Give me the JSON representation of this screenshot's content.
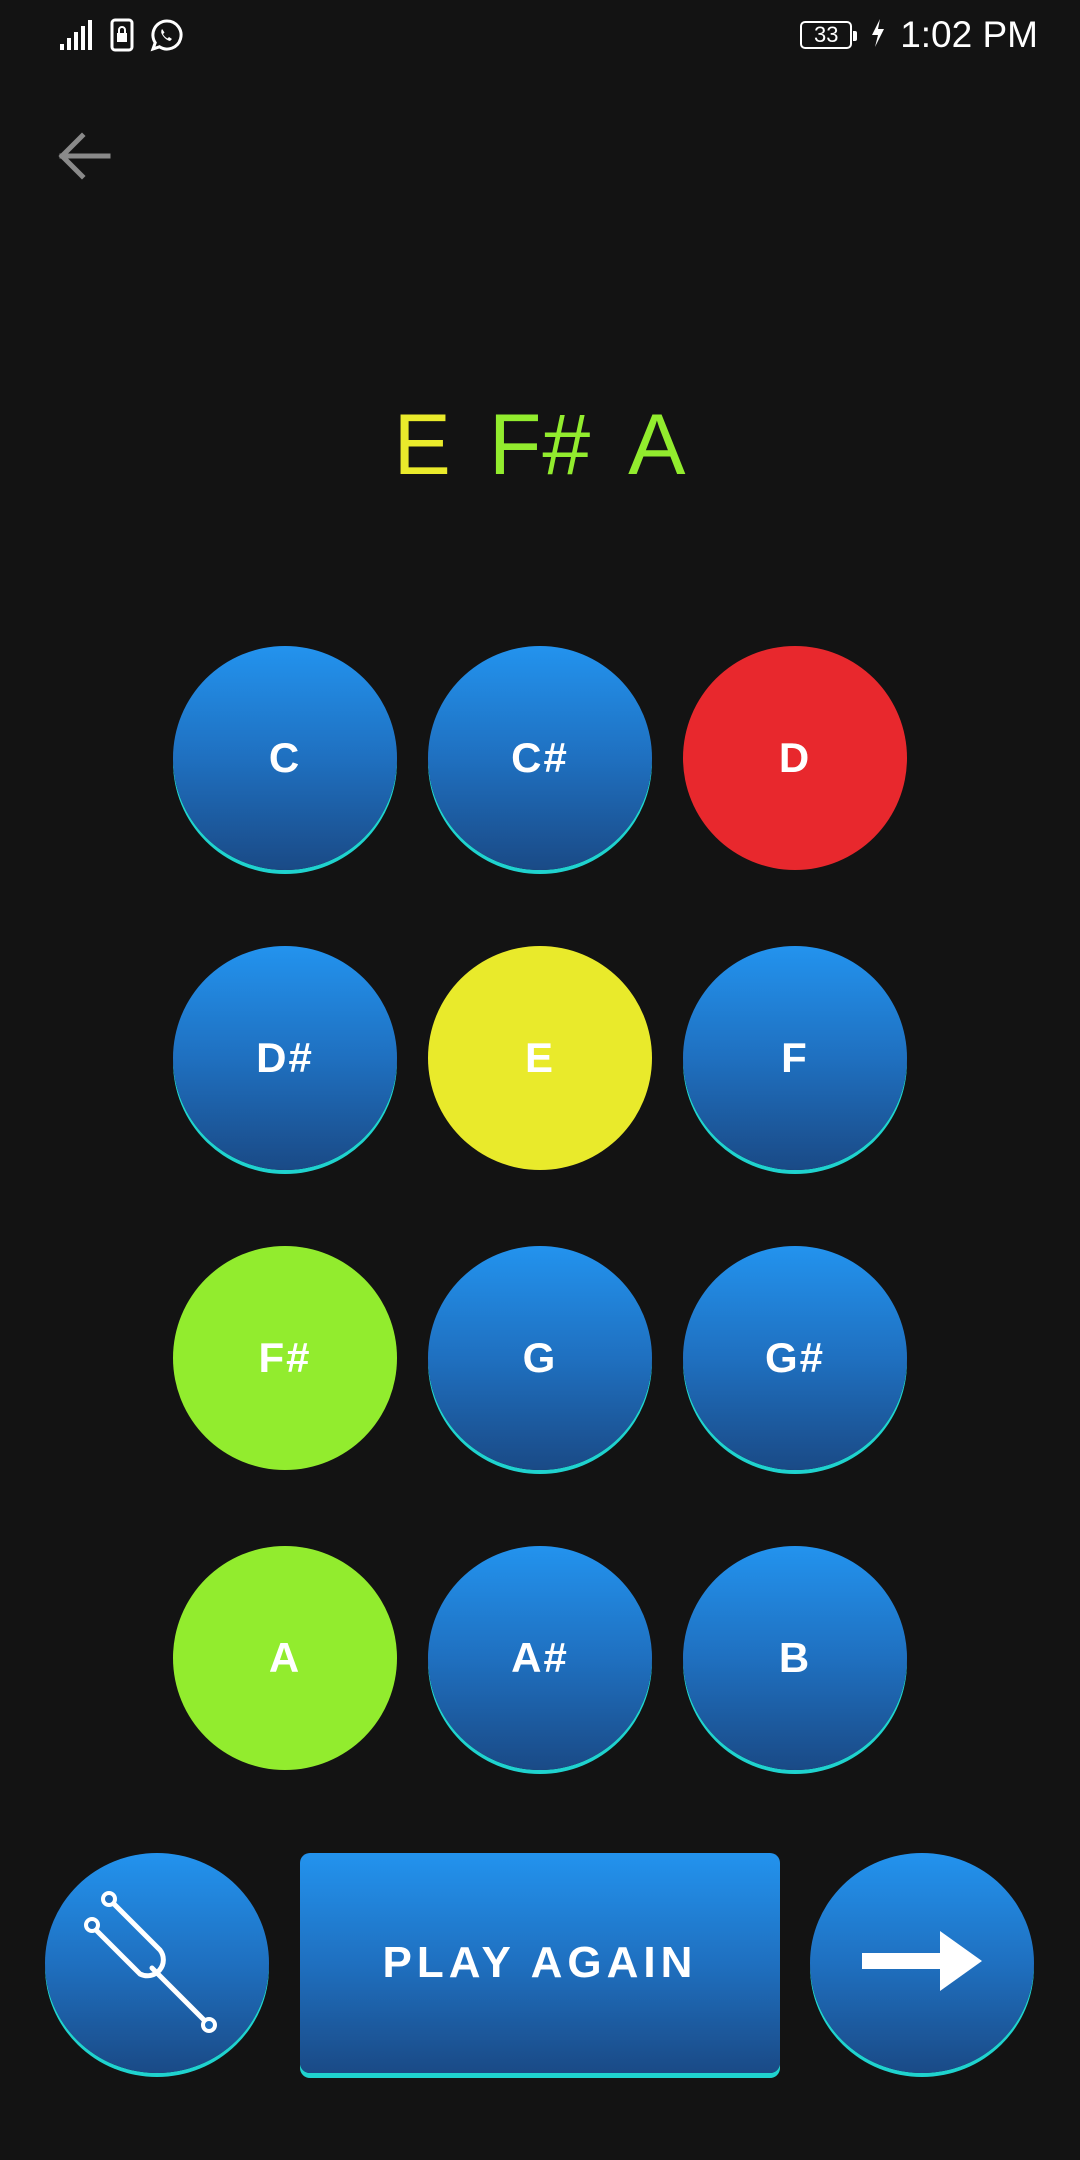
{
  "status_bar": {
    "battery_level": "33",
    "time": "1:02 PM",
    "icons": [
      "signal-icon",
      "sim-lock-icon",
      "whatsapp-icon",
      "battery-icon",
      "charging-icon"
    ]
  },
  "header": {
    "back_icon": "arrow-left-icon"
  },
  "answer": {
    "notes": [
      {
        "label": "E",
        "color": "#e9ea2b"
      },
      {
        "label": "F#",
        "color": "#92ec2e"
      },
      {
        "label": "A",
        "color": "#92ec2e"
      }
    ]
  },
  "notes": [
    {
      "label": "C",
      "state": "default"
    },
    {
      "label": "C#",
      "state": "default"
    },
    {
      "label": "D",
      "state": "wrong"
    },
    {
      "label": "D#",
      "state": "default"
    },
    {
      "label": "E",
      "state": "partial"
    },
    {
      "label": "F",
      "state": "default"
    },
    {
      "label": "F#",
      "state": "correct"
    },
    {
      "label": "G",
      "state": "default"
    },
    {
      "label": "G#",
      "state": "default"
    },
    {
      "label": "A",
      "state": "correct"
    },
    {
      "label": "A#",
      "state": "default"
    },
    {
      "label": "B",
      "state": "default"
    }
  ],
  "controls": {
    "tuning_fork_icon": "tuning-fork-icon",
    "play_again_label": "PLAY AGAIN",
    "next_icon": "arrow-right-icon"
  },
  "colors": {
    "background": "#131313",
    "button_blue": "#1f70c0",
    "button_edge": "#1fd3cf",
    "wrong": "#e8282d",
    "partial": "#e9ea2b",
    "correct": "#92ec2e"
  }
}
